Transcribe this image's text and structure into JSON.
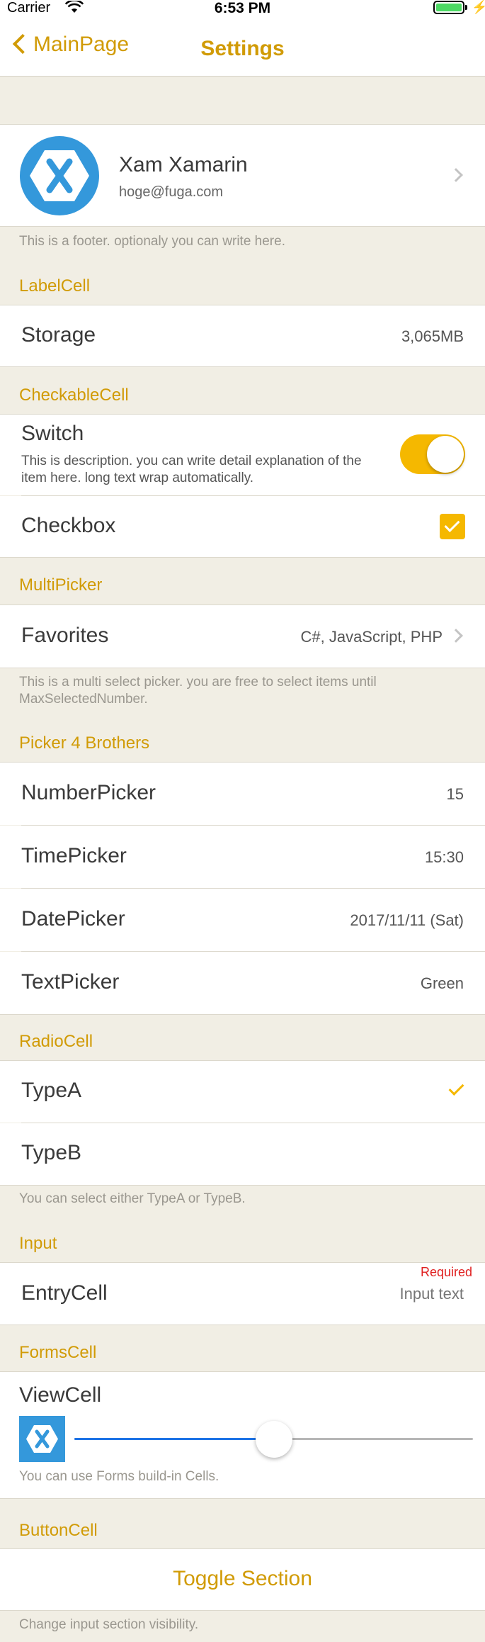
{
  "status_bar": {
    "carrier": "Carrier",
    "time": "6:53 PM"
  },
  "nav": {
    "back_label": "MainPage",
    "title": "Settings"
  },
  "profile": {
    "name": "Xam Xamarin",
    "email": "hoge@fuga.com",
    "footer": "This is a footer. optionaly you can write here."
  },
  "label_section": {
    "header": "LabelCell",
    "title": "Storage",
    "value": "3,065MB"
  },
  "checkable_section": {
    "header": "CheckableCell",
    "switch_title": "Switch",
    "switch_description": "This is description. you can write detail explanation of the item here. long text wrap automatically.",
    "switch_on": true,
    "checkbox_title": "Checkbox",
    "checkbox_checked": true
  },
  "multipicker_section": {
    "header": "MultiPicker",
    "title": "Favorites",
    "value": "C#, JavaScript, PHP",
    "footer": "This is a multi select picker. you are free to select items until MaxSelectedNumber."
  },
  "pickers_section": {
    "header": "Picker 4 Brothers",
    "number_title": "NumberPicker",
    "number_value": "15",
    "time_title": "TimePicker",
    "time_value": "15:30",
    "date_title": "DatePicker",
    "date_value": "2017/11/11 (Sat)",
    "text_title": "TextPicker",
    "text_value": "Green"
  },
  "radio_section": {
    "header": "RadioCell",
    "option_a": "TypeA",
    "option_b": "TypeB",
    "selected": "TypeA",
    "footer": "You can select either TypeA or TypeB."
  },
  "input_section": {
    "header": "Input",
    "title": "EntryCell",
    "required_label": "Required",
    "placeholder": "Input text"
  },
  "forms_section": {
    "header": "FormsCell",
    "title": "ViewCell",
    "slider_value": 0.5,
    "footer": "You can use Forms build-in Cells."
  },
  "button_section": {
    "header": "ButtonCell",
    "button_label": "Toggle Section",
    "footer": "Change input section visibility."
  },
  "colors": {
    "accent": "#d19b06",
    "background": "#f1eee4",
    "switch_on": "#f5b800",
    "slider": "#1e73e6",
    "xamarin_blue": "#3498db",
    "required": "#e02020"
  },
  "icons": [
    "wifi-icon",
    "battery-icon",
    "back-chevron-icon",
    "xamarin-logo-icon",
    "chevron-right-icon",
    "checkmark-icon"
  ]
}
